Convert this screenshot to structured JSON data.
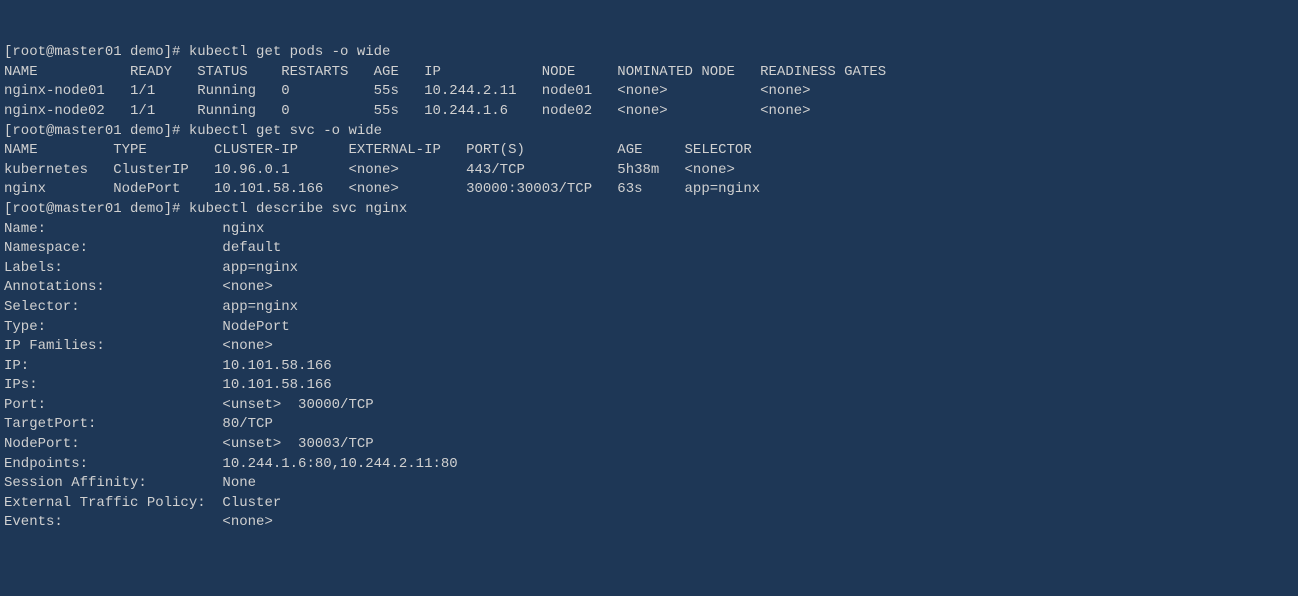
{
  "prompt1": "[root@master01 demo]# ",
  "cmd1": "kubectl get pods -o wide",
  "pods_header": {
    "name": "NAME",
    "ready": "READY",
    "status": "STATUS",
    "restarts": "RESTARTS",
    "age": "AGE",
    "ip": "IP",
    "node": "NODE",
    "nominated": "NOMINATED NODE",
    "readiness": "READINESS GATES"
  },
  "pods": [
    {
      "name": "nginx-node01",
      "ready": "1/1",
      "status": "Running",
      "restarts": "0",
      "age": "55s",
      "ip": "10.244.2.11",
      "node": "node01",
      "nominated": "<none>",
      "readiness": "<none>"
    },
    {
      "name": "nginx-node02",
      "ready": "1/1",
      "status": "Running",
      "restarts": "0",
      "age": "55s",
      "ip": "10.244.1.6",
      "node": "node02",
      "nominated": "<none>",
      "readiness": "<none>"
    }
  ],
  "prompt2": "[root@master01 demo]# ",
  "cmd2": "kubectl get svc -o wide",
  "svc_header": {
    "name": "NAME",
    "type": "TYPE",
    "clusterip": "CLUSTER-IP",
    "externalip": "EXTERNAL-IP",
    "ports": "PORT(S)",
    "age": "AGE",
    "selector": "SELECTOR"
  },
  "svcs": [
    {
      "name": "kubernetes",
      "type": "ClusterIP",
      "clusterip": "10.96.0.1",
      "externalip": "<none>",
      "ports": "443/TCP",
      "age": "5h38m",
      "selector": "<none>"
    },
    {
      "name": "nginx",
      "type": "NodePort",
      "clusterip": "10.101.58.166",
      "externalip": "<none>",
      "ports": "30000:30003/TCP",
      "age": "63s",
      "selector": "app=nginx"
    }
  ],
  "prompt3": "[root@master01 demo]# ",
  "cmd3": "kubectl describe svc nginx",
  "describe": [
    {
      "key": "Name:",
      "value": "nginx"
    },
    {
      "key": "Namespace:",
      "value": "default"
    },
    {
      "key": "Labels:",
      "value": "app=nginx"
    },
    {
      "key": "Annotations:",
      "value": "<none>"
    },
    {
      "key": "Selector:",
      "value": "app=nginx"
    },
    {
      "key": "Type:",
      "value": "NodePort"
    },
    {
      "key": "IP Families:",
      "value": "<none>"
    },
    {
      "key": "IP:",
      "value": "10.101.58.166"
    },
    {
      "key": "IPs:",
      "value": "10.101.58.166"
    },
    {
      "key": "Port:",
      "value": "<unset>  30000/TCP"
    },
    {
      "key": "TargetPort:",
      "value": "80/TCP"
    },
    {
      "key": "NodePort:",
      "value": "<unset>  30003/TCP"
    },
    {
      "key": "Endpoints:",
      "value": "10.244.1.6:80,10.244.2.11:80"
    },
    {
      "key": "Session Affinity:",
      "value": "None"
    },
    {
      "key": "External Traffic Policy:",
      "value": "Cluster"
    },
    {
      "key": "Events:",
      "value": "<none>"
    }
  ]
}
